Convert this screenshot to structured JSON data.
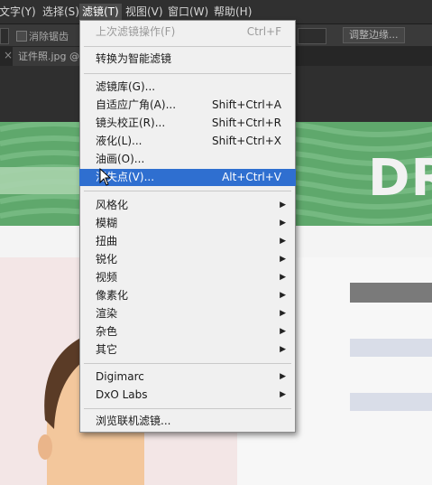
{
  "menubar": {
    "items": [
      {
        "label": "文字(Y)"
      },
      {
        "label": "选择(S)"
      },
      {
        "label": "滤镜(T)"
      },
      {
        "label": "视图(V)"
      },
      {
        "label": "窗口(W)"
      },
      {
        "label": "帮助(H)"
      }
    ],
    "active_index": 2
  },
  "optionsbar": {
    "checkbox_label": "消除锯齿",
    "refine_edge_button": "调整边缘..."
  },
  "document_tab": {
    "close_glyph": "×",
    "title": "证件照.jpg @"
  },
  "canvas": {
    "banner_text": "DR"
  },
  "filter_menu": {
    "last_filter": {
      "label": "上次滤镜操作(F)",
      "shortcut": "Ctrl+F",
      "disabled": true
    },
    "convert_smart": {
      "label": "转换为智能滤镜"
    },
    "group_main": [
      {
        "label": "滤镜库(G)...",
        "shortcut": ""
      },
      {
        "label": "自适应广角(A)...",
        "shortcut": "Shift+Ctrl+A"
      },
      {
        "label": "镜头校正(R)...",
        "shortcut": "Shift+Ctrl+R"
      },
      {
        "label": "液化(L)...",
        "shortcut": "Shift+Ctrl+X"
      },
      {
        "label": "油画(O)...",
        "shortcut": ""
      },
      {
        "label": "消失点(V)...",
        "shortcut": "Alt+Ctrl+V",
        "highlighted": true
      }
    ],
    "group_sub": [
      {
        "label": "风格化"
      },
      {
        "label": "模糊"
      },
      {
        "label": "扭曲"
      },
      {
        "label": "锐化"
      },
      {
        "label": "视频"
      },
      {
        "label": "像素化"
      },
      {
        "label": "渲染"
      },
      {
        "label": "杂色"
      },
      {
        "label": "其它"
      }
    ],
    "group_plugins": [
      {
        "label": "Digimarc"
      },
      {
        "label": "DxO Labs"
      }
    ],
    "browse_online": {
      "label": "浏览联机滤镜..."
    },
    "submenu_arrow": "▶"
  },
  "colors": {
    "menu_highlight": "#2f6fd0",
    "banner_green": "#5fa86c"
  }
}
